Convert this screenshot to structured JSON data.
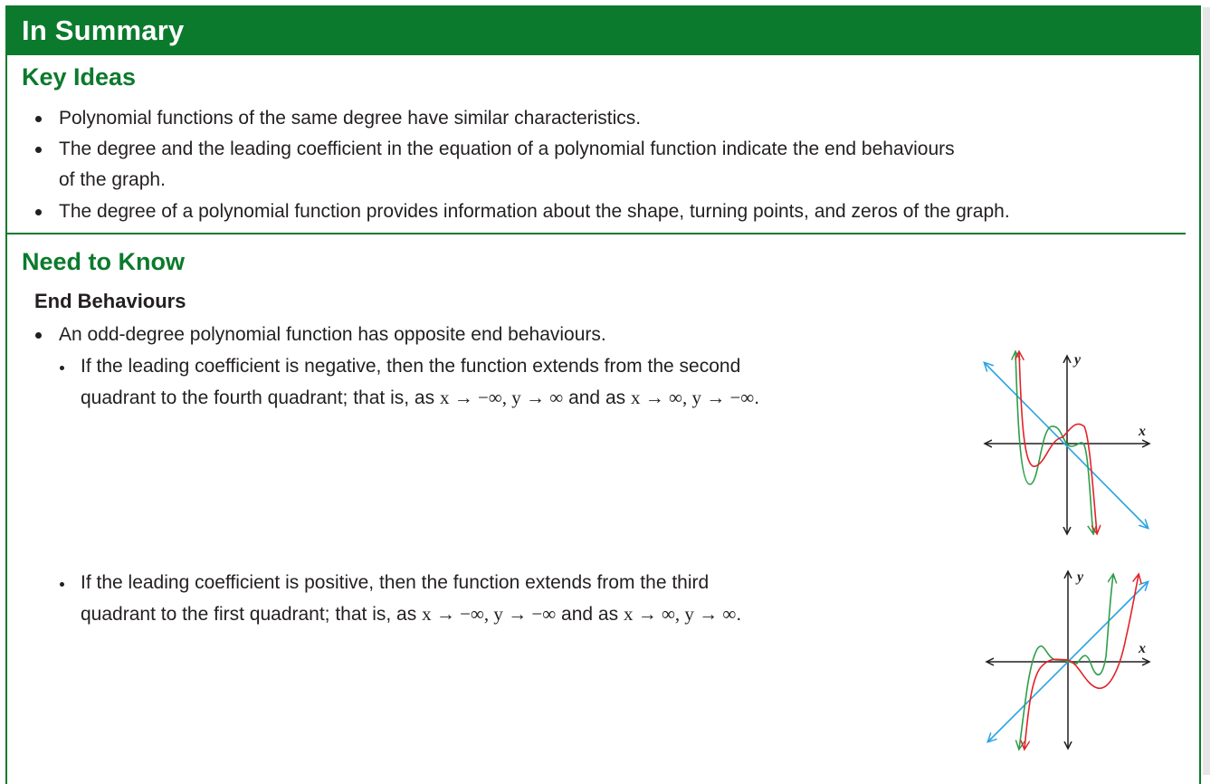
{
  "banner": {
    "title": "In Summary"
  },
  "key_ideas": {
    "heading": "Key Ideas",
    "bullets": [
      {
        "lines": [
          "Polynomial functions of the same degree have similar characteristics."
        ]
      },
      {
        "lines": [
          "The degree and the leading coefficient in the equation of a polynomial function indicate the end behaviours",
          "of the graph."
        ]
      },
      {
        "lines": [
          "The degree of a polynomial function provides information about the shape, turning points, and zeros of the graph."
        ]
      }
    ]
  },
  "need_to_know": {
    "heading": "Need to Know",
    "subheading": "End Behaviours",
    "bullet": "An odd-degree polynomial function has opposite end behaviours.",
    "items": [
      {
        "line1": "If the leading coefficient is negative, then the function extends from the second",
        "line2_text": "quadrant to the fourth quadrant; that is, as ",
        "math1": "x → −∞, y → ∞",
        "mid": " and as ",
        "math2": "x → ∞, y → −∞",
        "end": "."
      },
      {
        "line1": "If the leading coefficient is positive, then the function extends from the third",
        "line2_text": "quadrant to the first quadrant; that is, as ",
        "math1": "x → −∞, y → −∞",
        "mid": " and as ",
        "math2": "x → ∞, y → ∞",
        "end": "."
      }
    ]
  },
  "graphs": [
    {
      "x_label": "x",
      "y_label": "y",
      "leading_coefficient": "negative"
    },
    {
      "x_label": "x",
      "y_label": "y",
      "leading_coefficient": "positive"
    }
  ],
  "colors": {
    "accent": "#0b7a2c",
    "line_blue": "#2aa3e0",
    "curve_green": "#2e9e4a",
    "curve_red": "#e2232a"
  }
}
